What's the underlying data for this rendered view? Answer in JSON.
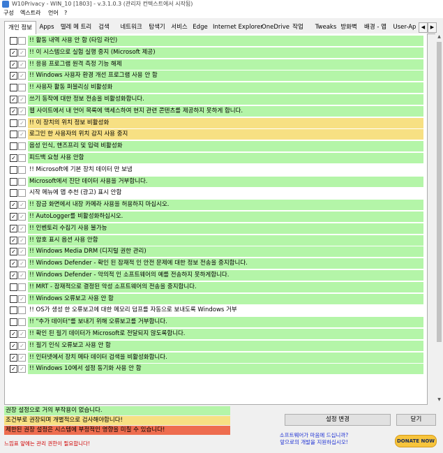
{
  "window": {
    "title": "W10Privacy - WIN_10 [1803] - v.3.1.0.3 (관리자 컨텍스트에서 시작됨)"
  },
  "menu": [
    "구성",
    "엑스트라",
    "언어",
    "?"
  ],
  "tabs": [
    {
      "label": "개인 정보",
      "active": true
    },
    {
      "label": "Apps"
    },
    {
      "label": "텔레 메 트리"
    },
    {
      "label": "검색"
    },
    {
      "label": "네트워크"
    },
    {
      "label": "탐색기"
    },
    {
      "label": "서비스"
    },
    {
      "label": "Edge"
    },
    {
      "label": "Internet Explorer"
    },
    {
      "label": "OneDrive"
    },
    {
      "label": "작업"
    },
    {
      "label": "Tweaks"
    },
    {
      "label": "방화벽"
    },
    {
      "label": "배경 - 앱"
    },
    {
      "label": "User-Ap"
    }
  ],
  "tab_scroll": {
    "left": "◀",
    "right": "▶"
  },
  "settings": [
    {
      "text": "!! 활동 내역 사용 안 함 (타임 라인)",
      "checked": false,
      "default": false,
      "level": "green"
    },
    {
      "text": "!! 이 시스템으로 실험 실행 중지 (Microsoft 제공)",
      "checked": true,
      "default": true,
      "level": "green"
    },
    {
      "text": "!! 응용 프로그램 원격 측정 기능 해제",
      "checked": true,
      "default": true,
      "level": "green"
    },
    {
      "text": "!! Windows 사용자 환경 개선 프로그램 사용 안 함",
      "checked": true,
      "default": true,
      "level": "green"
    },
    {
      "text": "!! 사용자 활동 퍼블리싱 비활성화",
      "checked": false,
      "default": false,
      "level": "green"
    },
    {
      "text": "쓰기 동작에 대한 정보 전송을 비활성화합니다.",
      "checked": true,
      "default": true,
      "level": "green"
    },
    {
      "text": "웹 사이트에서 내 언어 목록에 액세스하여 현지 관련 콘텐츠를 제공하지 못하게 합니다.",
      "checked": true,
      "default": true,
      "level": "green"
    },
    {
      "text": "!! 이 장치의 위치 정보 비활성화",
      "checked": false,
      "default": true,
      "level": "yellow"
    },
    {
      "text": "로그인 한 사용자의 위치 감지 사용 중지",
      "checked": false,
      "default": true,
      "level": "yellow"
    },
    {
      "text": "음성 인식, 핸즈프리 및 입력 비활성화",
      "checked": false,
      "default": false,
      "level": "green"
    },
    {
      "text": "피드백 요청 사용 안함",
      "checked": true,
      "default": false,
      "level": "green"
    },
    {
      "text": "!! Microsoft에 기본 장치 데이터 만 보냄",
      "checked": false,
      "default": false,
      "level": "none"
    },
    {
      "text": "Microsoft에서 진단 데이터 사용을 거부합니다.",
      "checked": false,
      "default": false,
      "level": "green"
    },
    {
      "text": "시작 메뉴에 앱 추천 (광고) 표시 안함",
      "checked": false,
      "default": false,
      "level": "none"
    },
    {
      "text": "!! 잠금 화면에서 내장 카메라 사용을 허용하지 마십시오.",
      "checked": true,
      "default": true,
      "level": "green"
    },
    {
      "text": "!! AutoLogger를 비활성화하십시오.",
      "checked": true,
      "default": true,
      "level": "green"
    },
    {
      "text": "!! 인벤토리 수집기 사용 불가능",
      "checked": true,
      "default": true,
      "level": "green"
    },
    {
      "text": "!! 암호 표시 옵션 사용 안함",
      "checked": true,
      "default": true,
      "level": "green"
    },
    {
      "text": "!! Windows Media DRM (디지털 권한 관리)",
      "checked": true,
      "default": true,
      "level": "green"
    },
    {
      "text": "!! Windows Defender - 확인 된 잠재적 인 안전 문제에 대한 정보 전송을 중지합니다.",
      "checked": true,
      "default": true,
      "level": "green"
    },
    {
      "text": "!! Windows Defender - 악의적 인 소프트웨어의 예를 전송하지 못하게합니다.",
      "checked": true,
      "default": true,
      "level": "green"
    },
    {
      "text": "!! MRT - 잠재적으로 결정된 악성 소프트웨어의 전송을 중지합니다.",
      "checked": false,
      "default": false,
      "level": "green"
    },
    {
      "text": "!! Windows 오류보고 사용 안 함",
      "checked": false,
      "default": true,
      "level": "green"
    },
    {
      "text": "!! OS가 생성 한 오류보고에 대한 메모리 덤프를 자동으로 보내도록 Windows 거부",
      "checked": false,
      "default": false,
      "level": "none"
    },
    {
      "text": "!! \"추가 데이터\"를 보내기 위해 오류보고를 거부합니다.",
      "checked": false,
      "default": false,
      "level": "green"
    },
    {
      "text": "!! 확인 된 필기 데이터가 Microsoft로 전달되지 않도록합니다.",
      "checked": true,
      "default": true,
      "level": "green"
    },
    {
      "text": "!! 필기 인식 오류보고 사용 안 함",
      "checked": true,
      "default": true,
      "level": "green"
    },
    {
      "text": "!! 인터넷에서 장치 메타 데이터 검색을 비활성화합니다.",
      "checked": true,
      "default": true,
      "level": "green"
    },
    {
      "text": "!! Windows 10에서 설정 동기화 사용 안 함",
      "checked": true,
      "default": true,
      "level": "green"
    }
  ],
  "check_glyph": "✓",
  "scroll": {
    "up": "▲",
    "down": "▼"
  },
  "legend": {
    "green": "권장 설정으로 거의 부작용이 없습니다.",
    "yellow": "조건부로 권장되며 개별적으로 검사해야합니다!",
    "red": "제한된 권장 설정은 시스템에 부정적인 영향을 미칠 수 있습니다!"
  },
  "admin_note": "느낌표 앞에는 관리 권한이 필요합니다!",
  "buttons": {
    "apply": "설정 변경",
    "close": "닫기"
  },
  "support": {
    "line1": "소프트웨어가 마음에 드십니까?",
    "line2": "앞으로의 개발을 지원하십시오!"
  },
  "donate": "DONATE NOW",
  "colors": {
    "green": "#b4f5a8",
    "yellow": "#f7e083",
    "red": "#ee6d4f",
    "support_text": "#1d2fd3",
    "admin_note": "#d00000"
  }
}
